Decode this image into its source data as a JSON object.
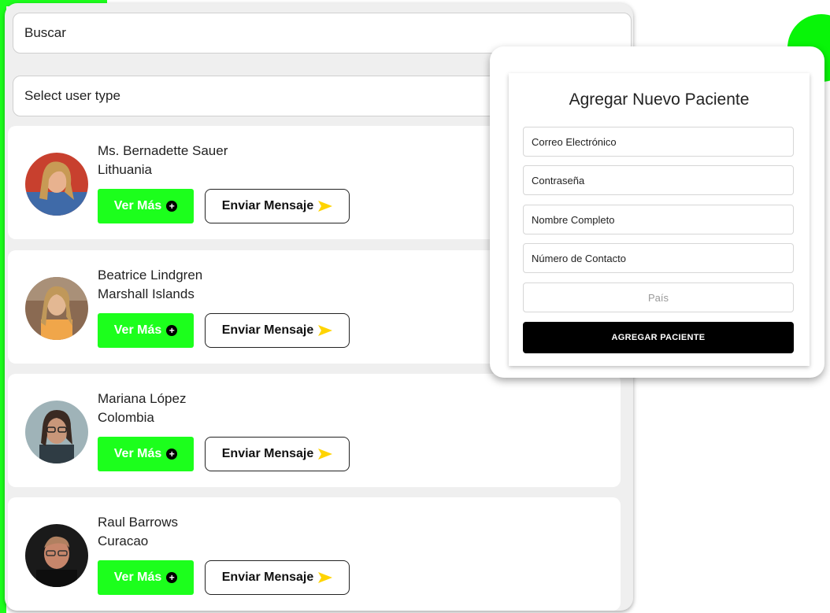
{
  "search": {
    "label": "Buscar"
  },
  "filter": {
    "label": "Select user type"
  },
  "patients": [
    {
      "name": "Ms. Bernadette Sauer",
      "country": "Lithuania",
      "more_label": "Ver Más",
      "message_label": "Enviar Mensaje"
    },
    {
      "name": "Beatrice Lindgren",
      "country": "Marshall Islands",
      "more_label": "Ver Más",
      "message_label": "Enviar Mensaje"
    },
    {
      "name": "Mariana López",
      "country": "Colombia",
      "more_label": "Ver Más",
      "message_label": "Enviar Mensaje"
    },
    {
      "name": "Raul Barrows",
      "country": "Curacao",
      "more_label": "Ver Más",
      "message_label": "Enviar Mensaje"
    }
  ],
  "form": {
    "title": "Agregar Nuevo Paciente",
    "email": "Correo Electrónico",
    "password": "Contraseña",
    "full_name": "Nombre Completo",
    "contact": "Número de Contacto",
    "country_placeholder": "País",
    "submit_label": "AGREGAR PACIENTE"
  },
  "colors": {
    "accent": "#1cff1c",
    "arrow": "#ffd400",
    "dark": "#000000"
  },
  "icons": {
    "plus": "plus-circle-icon",
    "send": "send-arrow-icon"
  }
}
